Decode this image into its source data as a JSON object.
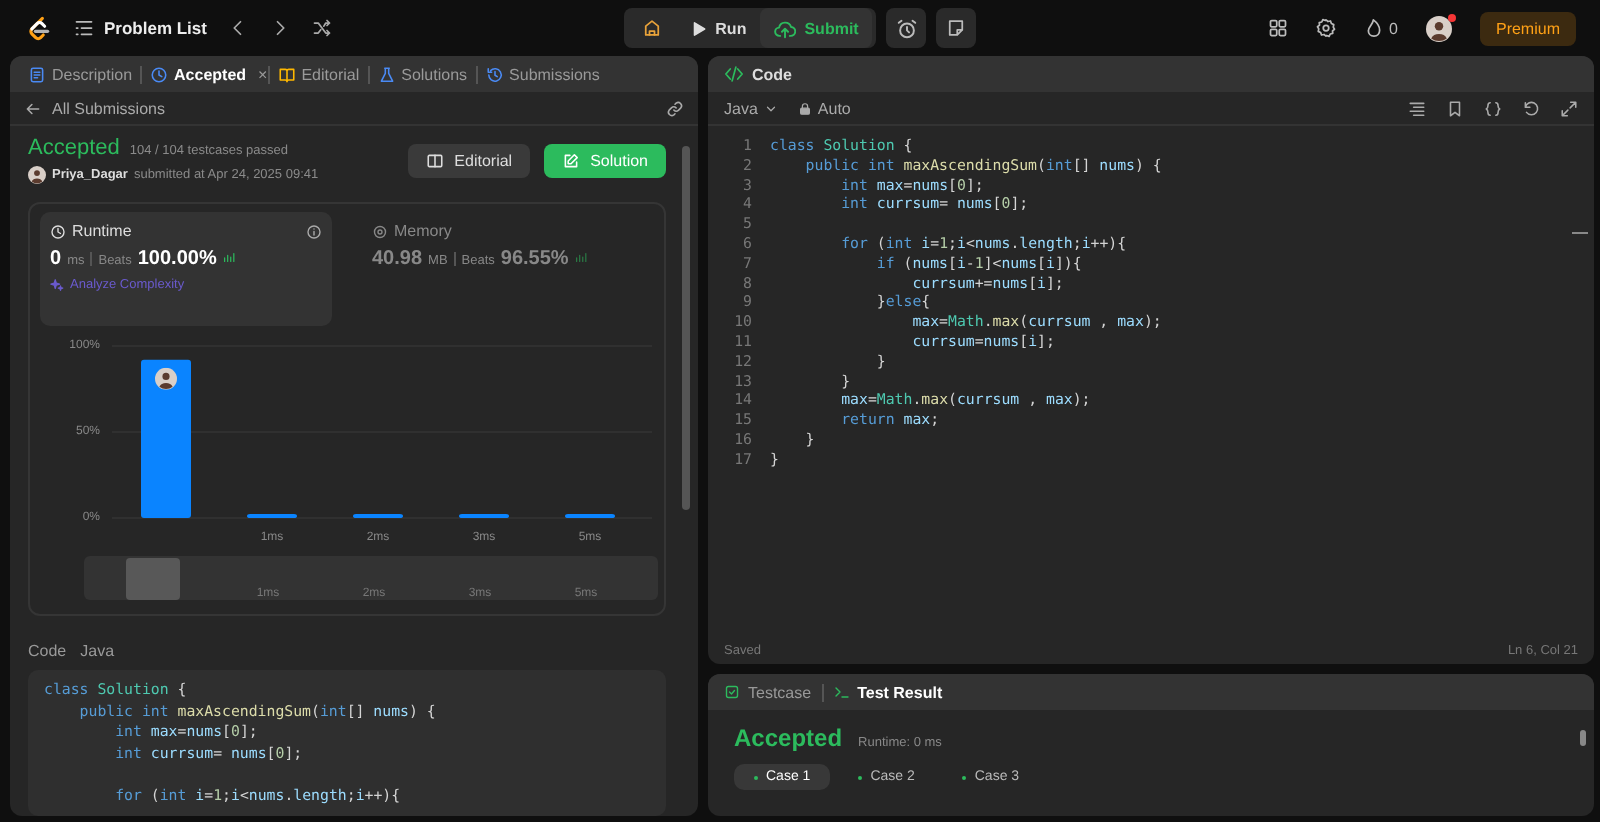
{
  "topbar": {
    "problem_list": "Problem List",
    "run": "Run",
    "submit": "Submit",
    "streak": "0",
    "notification": true,
    "premium": "Premium"
  },
  "left_panel": {
    "tabs": [
      {
        "label": "Description",
        "selected": false
      },
      {
        "label": "Accepted",
        "selected": true,
        "close": "×"
      },
      {
        "label": "Editorial",
        "selected": false
      },
      {
        "label": "Solutions",
        "selected": false
      },
      {
        "label": "Submissions",
        "selected": false
      }
    ],
    "back_link": "All Submissions",
    "submission": {
      "status": "Accepted",
      "testcases": "104 / 104 testcases passed",
      "user": "Priya_Dagar",
      "submitted": "submitted at Apr 24, 2025 09:41",
      "buttons": [
        {
          "label": "Editorial",
          "kind": "secondary"
        },
        {
          "label": "Solution",
          "kind": "primary"
        }
      ]
    },
    "stats": [
      {
        "title": "Runtime",
        "value": "0",
        "unit": "ms",
        "beats_label": "Beats",
        "beats": "100.00%",
        "selected": true,
        "link": "Analyze Complexity"
      },
      {
        "title": "Memory",
        "value": "40.98",
        "unit": "MB",
        "beats_label": "Beats",
        "beats": "96.55%",
        "selected": false
      }
    ],
    "chart_data": {
      "type": "bar",
      "categories": [
        null,
        "1ms",
        "2ms",
        "3ms",
        "5ms"
      ],
      "values": [
        92,
        2,
        2,
        2,
        2
      ],
      "ylim": [
        0,
        100
      ],
      "yticks": [
        {
          "value": 0,
          "label": "0%"
        },
        {
          "value": 50,
          "label": "50%"
        },
        {
          "value": 100,
          "label": "100%"
        }
      ]
    },
    "navigator_labels": [
      "1ms",
      "2ms",
      "3ms",
      "5ms"
    ],
    "code_label": "Code",
    "code_language": "Java",
    "code": [
      {
        "kind": "code",
        "segments": [
          {
            "text": "class ",
            "kind": "kw"
          },
          {
            "text": "Solution",
            "kind": "ty"
          },
          {
            "text": " {",
            "kind": "op"
          }
        ]
      },
      {
        "kind": "code",
        "segments": [
          {
            "text": "    public int ",
            "kind": "kw"
          },
          {
            "text": "maxAscendingSum",
            "kind": "fn"
          },
          {
            "text": "(",
            "kind": "op"
          },
          {
            "text": "int",
            "kind": "kw"
          },
          {
            "text": "[] ",
            "kind": "op"
          },
          {
            "text": "nums",
            "kind": "var"
          },
          {
            "text": ") {",
            "kind": "op"
          }
        ]
      },
      {
        "kind": "code",
        "segments": [
          {
            "text": "        int ",
            "kind": "kw"
          },
          {
            "text": "max",
            "kind": "var"
          },
          {
            "text": "=",
            "kind": "op"
          },
          {
            "text": "nums",
            "kind": "var"
          },
          {
            "text": "[",
            "kind": "op"
          },
          {
            "text": "0",
            "kind": "num"
          },
          {
            "text": "];",
            "kind": "op"
          }
        ]
      },
      {
        "kind": "code",
        "segments": [
          {
            "text": "        int ",
            "kind": "kw"
          },
          {
            "text": "currsum",
            "kind": "var"
          },
          {
            "text": "= ",
            "kind": "op"
          },
          {
            "text": "nums",
            "kind": "var"
          },
          {
            "text": "[",
            "kind": "op"
          },
          {
            "text": "0",
            "kind": "num"
          },
          {
            "text": "];",
            "kind": "op"
          }
        ]
      },
      {
        "kind": "blank"
      },
      {
        "kind": "code",
        "segments": [
          {
            "text": "        for ",
            "kind": "kw"
          },
          {
            "text": "(",
            "kind": "op"
          },
          {
            "text": "int ",
            "kind": "kw"
          },
          {
            "text": "i",
            "kind": "var"
          },
          {
            "text": "=",
            "kind": "op"
          },
          {
            "text": "1",
            "kind": "num"
          },
          {
            "text": ";",
            "kind": "op"
          },
          {
            "text": "i",
            "kind": "var"
          },
          {
            "text": "<",
            "kind": "op"
          },
          {
            "text": "nums",
            "kind": "var"
          },
          {
            "text": ".",
            "kind": "op"
          },
          {
            "text": "length",
            "kind": "var"
          },
          {
            "text": ";",
            "kind": "op"
          },
          {
            "text": "i",
            "kind": "var"
          },
          {
            "text": "++){",
            "kind": "op"
          }
        ]
      }
    ]
  },
  "editor": {
    "title": "Code",
    "language": "Java",
    "mode": "Auto",
    "status": "Saved",
    "cursor": "Ln 6, Col 21",
    "lines": [
      {
        "number": "1",
        "kind": "code",
        "segments": [
          {
            "text": "class ",
            "kind": "kw"
          },
          {
            "text": "Solution",
            "kind": "ty"
          },
          {
            "text": " {",
            "kind": "op"
          }
        ]
      },
      {
        "number": "2",
        "kind": "code",
        "segments": [
          {
            "text": "    public int ",
            "kind": "kw"
          },
          {
            "text": "maxAscendingSum",
            "kind": "fn"
          },
          {
            "text": "(",
            "kind": "op"
          },
          {
            "text": "int",
            "kind": "kw"
          },
          {
            "text": "[] ",
            "kind": "op"
          },
          {
            "text": "nums",
            "kind": "var"
          },
          {
            "text": ") {",
            "kind": "op"
          }
        ]
      },
      {
        "number": "3",
        "kind": "code",
        "segments": [
          {
            "text": "        int ",
            "kind": "kw"
          },
          {
            "text": "max",
            "kind": "var"
          },
          {
            "text": "=",
            "kind": "op"
          },
          {
            "text": "nums",
            "kind": "var"
          },
          {
            "text": "[",
            "kind": "op"
          },
          {
            "text": "0",
            "kind": "num"
          },
          {
            "text": "];",
            "kind": "op"
          }
        ]
      },
      {
        "number": "4",
        "kind": "code",
        "segments": [
          {
            "text": "        int ",
            "kind": "kw"
          },
          {
            "text": "currsum",
            "kind": "var"
          },
          {
            "text": "= ",
            "kind": "op"
          },
          {
            "text": "nums",
            "kind": "var"
          },
          {
            "text": "[",
            "kind": "op"
          },
          {
            "text": "0",
            "kind": "num"
          },
          {
            "text": "];",
            "kind": "op"
          }
        ]
      },
      {
        "number": "5",
        "kind": "blank"
      },
      {
        "number": "6",
        "kind": "code",
        "segments": [
          {
            "text": "        for ",
            "kind": "kw"
          },
          {
            "text": "(",
            "kind": "op"
          },
          {
            "text": "int ",
            "kind": "kw"
          },
          {
            "text": "i",
            "kind": "var"
          },
          {
            "text": "=",
            "kind": "op"
          },
          {
            "text": "1",
            "kind": "num"
          },
          {
            "text": ";",
            "kind": "op"
          },
          {
            "text": "i",
            "kind": "var"
          },
          {
            "text": "<",
            "kind": "op"
          },
          {
            "text": "nums",
            "kind": "var"
          },
          {
            "text": ".",
            "kind": "op"
          },
          {
            "text": "length",
            "kind": "var"
          },
          {
            "text": ";",
            "kind": "op"
          },
          {
            "text": "i",
            "kind": "var"
          },
          {
            "text": "++){",
            "kind": "op"
          }
        ]
      },
      {
        "number": "7",
        "kind": "code",
        "segments": [
          {
            "text": "            if ",
            "kind": "kw"
          },
          {
            "text": "(",
            "kind": "op"
          },
          {
            "text": "nums",
            "kind": "var"
          },
          {
            "text": "[",
            "kind": "op"
          },
          {
            "text": "i",
            "kind": "var"
          },
          {
            "text": "-",
            "kind": "op"
          },
          {
            "text": "1",
            "kind": "num"
          },
          {
            "text": "]<",
            "kind": "op"
          },
          {
            "text": "nums",
            "kind": "var"
          },
          {
            "text": "[",
            "kind": "op"
          },
          {
            "text": "i",
            "kind": "var"
          },
          {
            "text": "]){",
            "kind": "op"
          }
        ]
      },
      {
        "number": "8",
        "kind": "code",
        "segments": [
          {
            "text": "                currsum",
            "kind": "var"
          },
          {
            "text": "+=",
            "kind": "op"
          },
          {
            "text": "nums",
            "kind": "var"
          },
          {
            "text": "[",
            "kind": "op"
          },
          {
            "text": "i",
            "kind": "var"
          },
          {
            "text": "];",
            "kind": "op"
          }
        ]
      },
      {
        "number": "9",
        "kind": "code",
        "segments": [
          {
            "text": "            }",
            "kind": "op"
          },
          {
            "text": "else",
            "kind": "kw"
          },
          {
            "text": "{",
            "kind": "op"
          }
        ]
      },
      {
        "number": "10",
        "kind": "code",
        "segments": [
          {
            "text": "                max",
            "kind": "var"
          },
          {
            "text": "=",
            "kind": "op"
          },
          {
            "text": "Math",
            "kind": "ty"
          },
          {
            "text": ".",
            "kind": "op"
          },
          {
            "text": "max",
            "kind": "fn"
          },
          {
            "text": "(",
            "kind": "op"
          },
          {
            "text": "currsum",
            "kind": "var"
          },
          {
            "text": " , ",
            "kind": "op"
          },
          {
            "text": "max",
            "kind": "var"
          },
          {
            "text": ");",
            "kind": "op"
          }
        ]
      },
      {
        "number": "11",
        "kind": "code",
        "segments": [
          {
            "text": "                currsum",
            "kind": "var"
          },
          {
            "text": "=",
            "kind": "op"
          },
          {
            "text": "nums",
            "kind": "var"
          },
          {
            "text": "[",
            "kind": "op"
          },
          {
            "text": "i",
            "kind": "var"
          },
          {
            "text": "];",
            "kind": "op"
          }
        ]
      },
      {
        "number": "12",
        "kind": "code",
        "segments": [
          {
            "text": "            }",
            "kind": "op"
          }
        ]
      },
      {
        "number": "13",
        "kind": "code",
        "segments": [
          {
            "text": "        }",
            "kind": "op"
          }
        ]
      },
      {
        "number": "14",
        "kind": "code",
        "segments": [
          {
            "text": "        max",
            "kind": "var"
          },
          {
            "text": "=",
            "kind": "op"
          },
          {
            "text": "Math",
            "kind": "ty"
          },
          {
            "text": ".",
            "kind": "op"
          },
          {
            "text": "max",
            "kind": "fn"
          },
          {
            "text": "(",
            "kind": "op"
          },
          {
            "text": "currsum",
            "kind": "var"
          },
          {
            "text": " , ",
            "kind": "op"
          },
          {
            "text": "max",
            "kind": "var"
          },
          {
            "text": ");",
            "kind": "op"
          }
        ]
      },
      {
        "number": "15",
        "kind": "code",
        "segments": [
          {
            "text": "        return ",
            "kind": "kw"
          },
          {
            "text": "max",
            "kind": "var"
          },
          {
            "text": ";",
            "kind": "op"
          }
        ]
      },
      {
        "number": "16",
        "kind": "code",
        "segments": [
          {
            "text": "    }",
            "kind": "op"
          }
        ]
      },
      {
        "number": "17",
        "kind": "code",
        "segments": [
          {
            "text": "}",
            "kind": "op"
          }
        ]
      }
    ]
  },
  "result_panel": {
    "tabs": [
      {
        "label": "Testcase",
        "selected": false
      },
      {
        "label": "Test Result",
        "selected": true
      }
    ],
    "status": "Accepted",
    "runtime": "Runtime: 0 ms",
    "cases": [
      {
        "label": "Case 1",
        "selected": true
      },
      {
        "label": "Case 2",
        "selected": false
      },
      {
        "label": "Case 3",
        "selected": false
      }
    ]
  }
}
